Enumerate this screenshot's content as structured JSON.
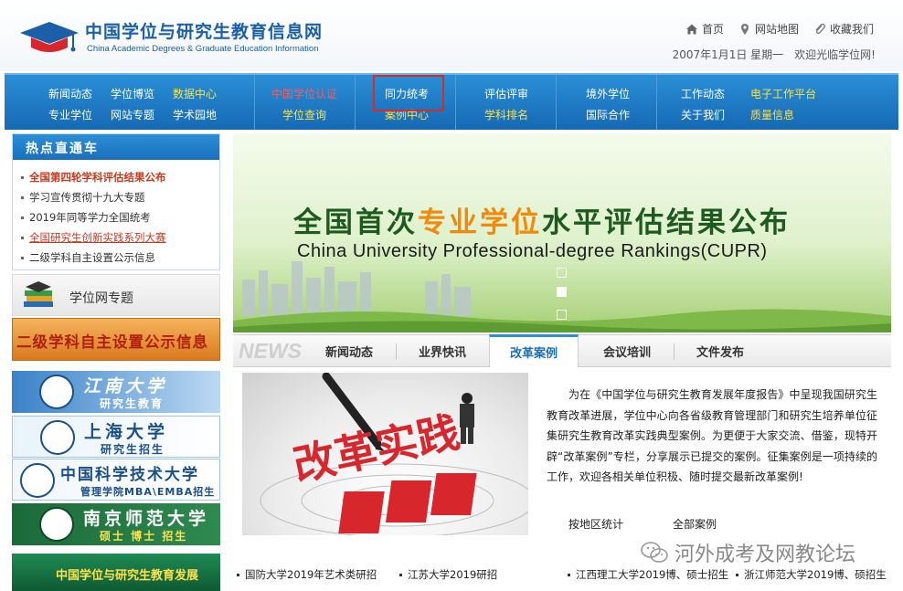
{
  "header": {
    "logo_cn": "中国学位与研究生教育信息网",
    "logo_en": "China Academic Degrees & Graduate Education Information",
    "links": {
      "home": "首页",
      "sitemap": "网站地图",
      "favorite": "收藏我们"
    },
    "date_line": "2007年1月1日 星期一　欢迎光临学位网!",
    "icons": {
      "home": "home-icon",
      "sitemap": "map-pin-icon",
      "favorite": "paperclip-icon"
    }
  },
  "nav": {
    "g1": {
      "r1": [
        "新闻动态",
        "学位博览",
        "数据中心"
      ],
      "r2": [
        "专业学位",
        "网站专题",
        "学术园地"
      ]
    },
    "g2": {
      "r1": "中国学位认证",
      "r2": "学位查询"
    },
    "g3": {
      "r1": "同力统考",
      "r2": "案例中心"
    },
    "g4": {
      "r1": "评估评审",
      "r2": "学科排名"
    },
    "g5": {
      "r1": "境外学位",
      "r2": "国际合作"
    },
    "g6": {
      "r1": [
        "工作动态",
        "电子工作平台"
      ],
      "r2": [
        "关于我们",
        "质量信息"
      ]
    },
    "colors": {
      "bg_top": "#2a8fd6",
      "bg_bottom": "#1669b3",
      "text": "#ffffff",
      "accent": "#ffe14a",
      "highlight_border": "#d52b2b"
    }
  },
  "hot": {
    "title": "热点直通车",
    "items": [
      "全国第四轮学科评估结果公布",
      "学习宣传贯彻十九大专题",
      "2019年同等学力全国统考",
      "全国研究生创新实践系列大赛",
      "二级学科自主设置公示信息"
    ]
  },
  "topics": {
    "label": "学位网专题"
  },
  "banner_erji": {
    "label": "二级学科自主设置公示信息"
  },
  "universities": [
    {
      "name": "江南大学",
      "sub": "研究生教育"
    },
    {
      "name": "上海大学",
      "sub": "研究生招生"
    },
    {
      "name": "中国科学技术大学",
      "sub": "管理学院MBA\\EMBA招生"
    },
    {
      "name": "南京师范大学",
      "sub": "硕士 博士 招生"
    }
  ],
  "banner_annual": {
    "label": "中国学位与研究生教育发展"
  },
  "hero": {
    "title_pre": "全国首次",
    "title_hl": "专业学位",
    "title_post": "水平评估结果公布",
    "subtitle": "China University Professional-degree Rankings(CUPR)",
    "colors": {
      "title": "#1c5a1f",
      "highlight": "#f08a0c"
    }
  },
  "tabs": {
    "news_word": "NEWS",
    "items": [
      "新闻动态",
      "业界快讯",
      "改革案例",
      "会议培训",
      "文件发布"
    ],
    "active": "改革案例"
  },
  "content": {
    "image_text": "改革实践",
    "paragraph": "为在《中国学位与研究生教育发展年度报告》中呈现我国研究生教育改革进展，学位中心向各省级教育管理部门和研究生培养单位征集研究生教育改革实践典型案例。为更便于大家交流、借鉴，现特开辟“改革案例”专栏，分享展示已提交的案例。征集案例是一项持续的工作，欢迎各相关单位积极、随时提交最新改革案例!",
    "link_region": "按地区统计",
    "link_all": "全部案例"
  },
  "watermark": {
    "text": "河外成考及网教论坛",
    "icon": "wechat-icon"
  },
  "ticker": [
    "国防大学2019年艺术类研招",
    "江苏大学2019研招",
    "江西理工大学2019博、硕士招生",
    "浙江师范大学2019博、硕招生"
  ]
}
